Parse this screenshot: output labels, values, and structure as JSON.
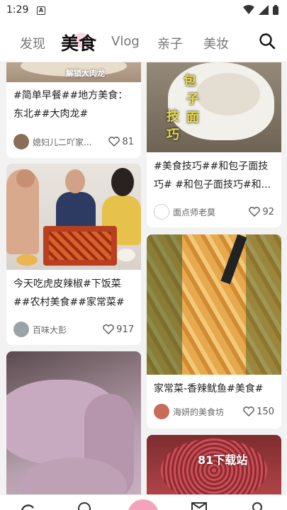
{
  "status": {
    "time": "1:29",
    "notification": "A"
  },
  "nav": {
    "tabs": [
      {
        "label": "发现",
        "active": false
      },
      {
        "label": "美食",
        "active": true
      },
      {
        "label": "Vlog",
        "active": false
      },
      {
        "label": "亲子",
        "active": false
      },
      {
        "label": "美妆",
        "active": false
      }
    ],
    "search_icon": "search-icon"
  },
  "feed": {
    "left": [
      {
        "thumb_text": "解锁大肉龙",
        "caption": "#简单早餐##地方美食：东北##大肉龙#",
        "author": "媳妇儿二吖家...",
        "likes": "81"
      },
      {
        "thumb_text": "",
        "caption": "今天吃虎皮辣椒#下饭菜##农村美食##家常菜#",
        "author": "百味大彭",
        "likes": "917"
      },
      {
        "thumb_text": "",
        "caption": "",
        "author": "",
        "likes": ""
      }
    ],
    "right": [
      {
        "thumb_text": [
          "包",
          "子",
          "面",
          "技",
          "巧"
        ],
        "caption": "#美食技巧##和包子面技巧# #和包子面技巧#和...",
        "author": "面点师老莫",
        "likes": "92"
      },
      {
        "thumb_text": "",
        "caption": "家常菜-香辣鱿鱼#美食#",
        "author": "海妍的美食坊",
        "likes": "150"
      },
      {
        "thumb_text": "81下载站",
        "caption": "",
        "author": "",
        "likes": ""
      }
    ]
  },
  "colors": {
    "accent": "#f06292",
    "text": "#222222",
    "muted": "#777777"
  }
}
